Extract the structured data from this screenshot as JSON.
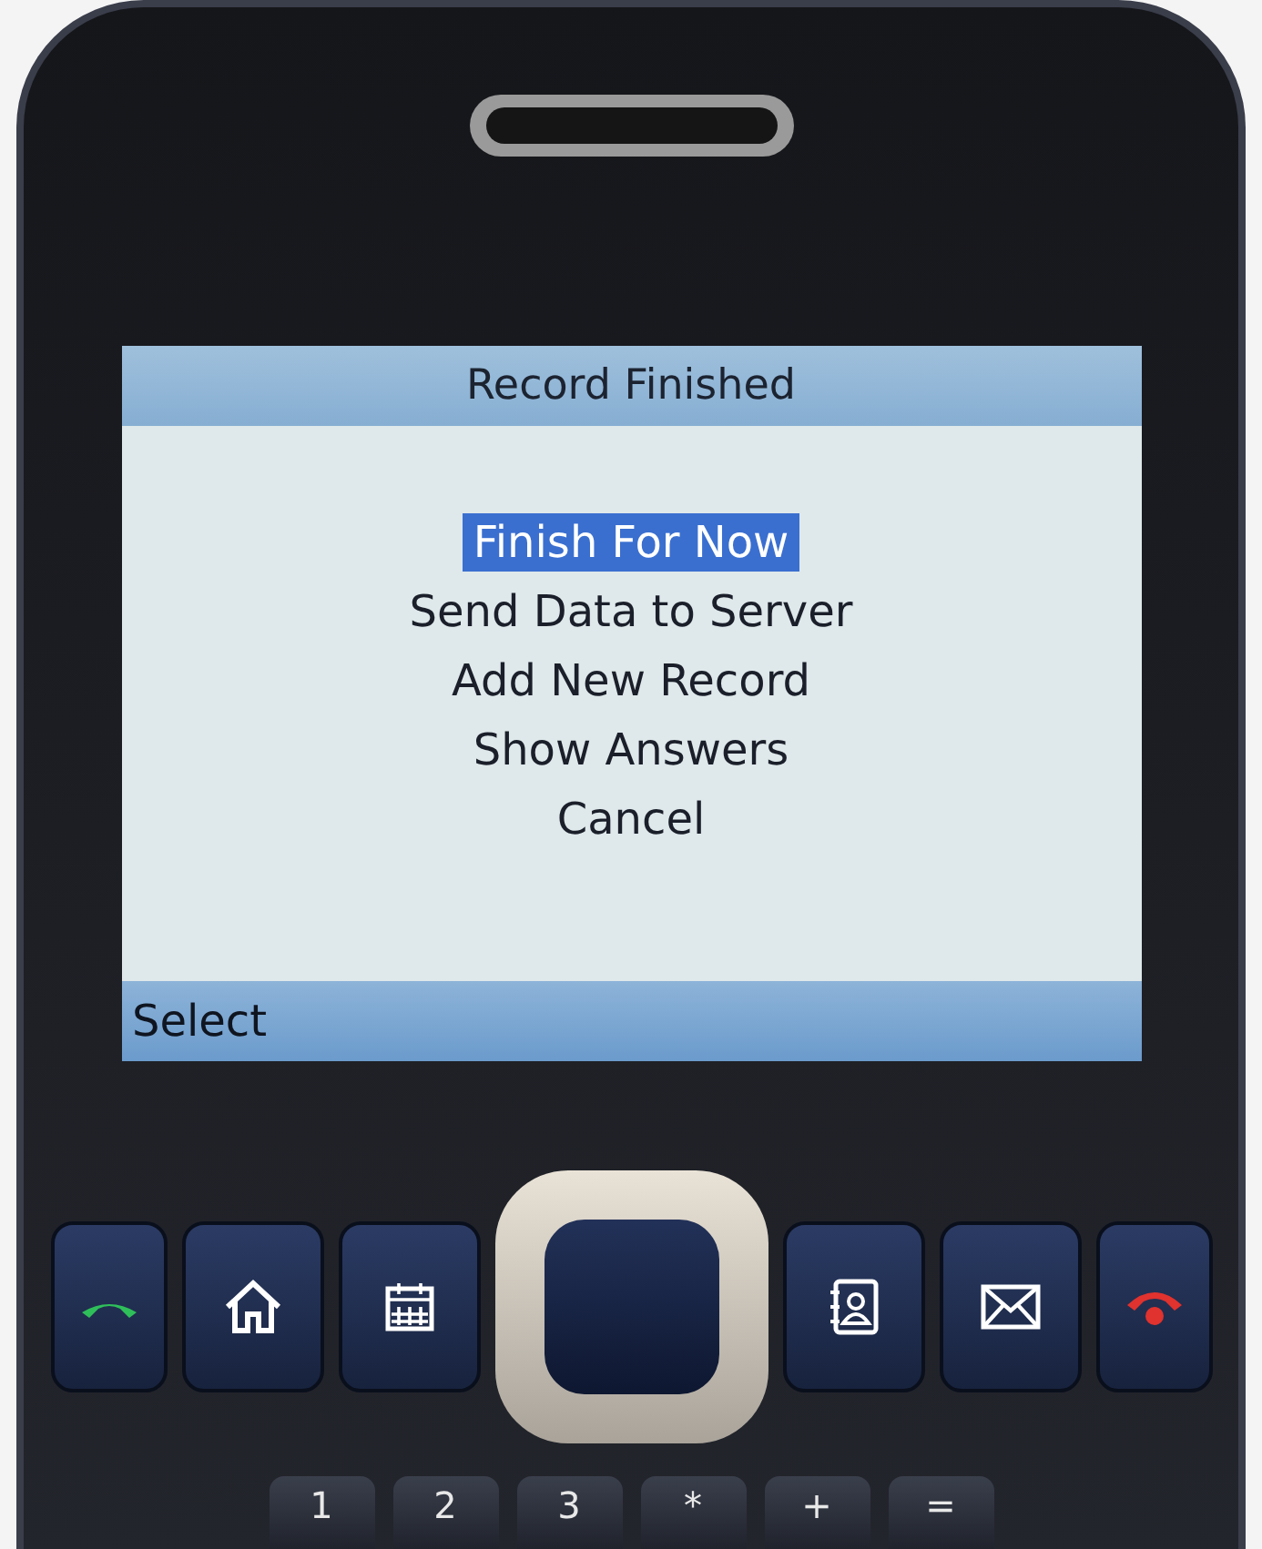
{
  "screen": {
    "title": "Record Finished",
    "menu": [
      {
        "label": "Finish For Now",
        "selected": true
      },
      {
        "label": "Send Data to Server",
        "selected": false
      },
      {
        "label": "Add New Record",
        "selected": false
      },
      {
        "label": "Show Answers",
        "selected": false
      },
      {
        "label": "Cancel",
        "selected": false
      }
    ],
    "softkey": "Select"
  },
  "keypad": {
    "bottom_keys": [
      "1",
      "2",
      "3",
      "*",
      "+",
      "="
    ]
  }
}
